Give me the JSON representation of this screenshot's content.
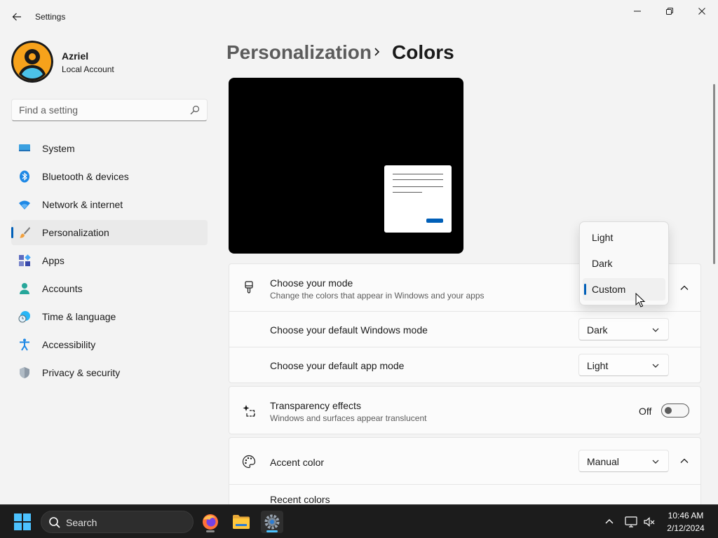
{
  "window": {
    "title": "Settings"
  },
  "profile": {
    "name": "Azriel",
    "account_type": "Local Account"
  },
  "search": {
    "placeholder": "Find a setting"
  },
  "sidebar": {
    "items": [
      {
        "label": "System",
        "icon": "system-icon"
      },
      {
        "label": "Bluetooth & devices",
        "icon": "bluetooth-icon"
      },
      {
        "label": "Network & internet",
        "icon": "wifi-icon"
      },
      {
        "label": "Personalization",
        "icon": "paintbrush-icon",
        "active": true
      },
      {
        "label": "Apps",
        "icon": "apps-icon"
      },
      {
        "label": "Accounts",
        "icon": "person-icon"
      },
      {
        "label": "Time & language",
        "icon": "globe-clock-icon"
      },
      {
        "label": "Accessibility",
        "icon": "accessibility-icon"
      },
      {
        "label": "Privacy & security",
        "icon": "shield-icon"
      }
    ]
  },
  "breadcrumb": {
    "parent": "Personalization",
    "current": "Colors"
  },
  "mode_card": {
    "title": "Choose your mode",
    "description": "Change the colors that appear in Windows and your apps",
    "menu_options": [
      "Light",
      "Dark",
      "Custom"
    ],
    "selected_option": "Custom",
    "windows_mode": {
      "label": "Choose your default Windows mode",
      "value": "Dark"
    },
    "app_mode": {
      "label": "Choose your default app mode",
      "value": "Light"
    }
  },
  "transparency_card": {
    "title": "Transparency effects",
    "description": "Windows and surfaces appear translucent",
    "state_label": "Off"
  },
  "accent_card": {
    "title": "Accent color",
    "value": "Manual",
    "recent_label": "Recent colors"
  },
  "taskbar": {
    "search_label": "Search",
    "time": "10:46 AM",
    "date": "2/12/2024"
  },
  "colors": {
    "accent": "#005fb8",
    "taskbar_bg": "#1c1c1c",
    "page_bg": "#f3f3f3"
  }
}
